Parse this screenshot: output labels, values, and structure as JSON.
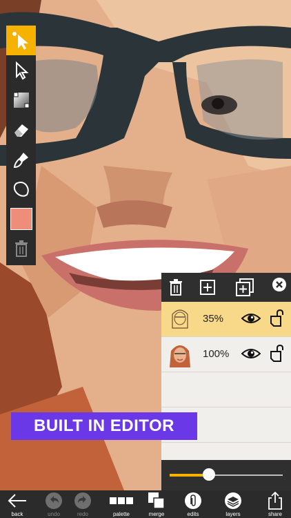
{
  "banner": {
    "text": "BUILT IN EDITOR",
    "color": "#6b38e8"
  },
  "toolbar": {
    "tools": [
      {
        "name": "select-auto-icon",
        "active": true
      },
      {
        "name": "pointer-icon",
        "active": false
      },
      {
        "name": "gradient-icon",
        "active": false
      },
      {
        "name": "eraser-icon",
        "active": false
      },
      {
        "name": "brush-icon",
        "active": false
      },
      {
        "name": "blob-shape-icon",
        "active": false
      },
      {
        "name": "color-swatch",
        "active": false,
        "color": "#ee8d7a"
      },
      {
        "name": "trash-icon",
        "active": false
      }
    ],
    "accent": "#f5b300"
  },
  "layers": {
    "header_icons": [
      "trash-icon",
      "add-layer-icon",
      "duplicate-layer-icon",
      "close-icon"
    ],
    "rows": [
      {
        "opacity": "35%",
        "selected": true,
        "visible": true
      },
      {
        "opacity": "100%",
        "selected": false,
        "visible": true
      }
    ],
    "opacity_slider_value": 0.35
  },
  "bottombar": {
    "items": [
      {
        "label": "back",
        "icon": "back-arrow-icon",
        "enabled": true
      },
      {
        "label": "undo",
        "icon": "undo-icon",
        "enabled": false
      },
      {
        "label": "redo",
        "icon": "redo-icon",
        "enabled": false
      },
      {
        "label": "palette",
        "icon": "palette-icon",
        "enabled": true
      },
      {
        "label": "merge",
        "icon": "merge-icon",
        "enabled": true
      },
      {
        "label": "edits",
        "icon": "paperclip-icon",
        "enabled": true
      },
      {
        "label": "layers",
        "icon": "layers-icon",
        "enabled": true
      },
      {
        "label": "share",
        "icon": "share-icon",
        "enabled": true
      }
    ]
  }
}
